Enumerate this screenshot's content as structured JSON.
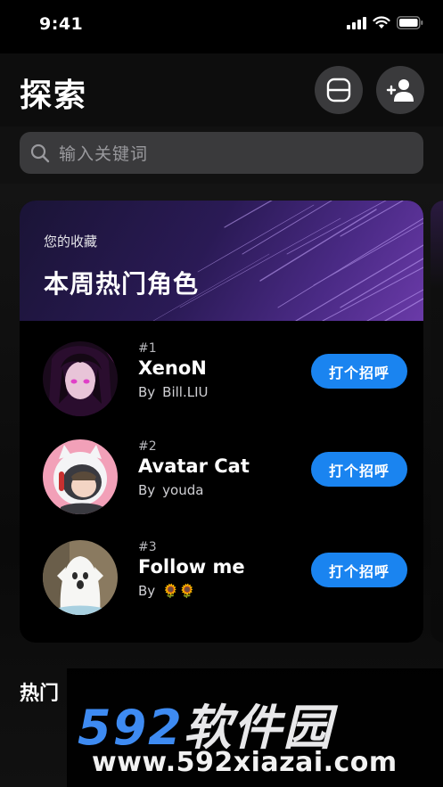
{
  "status": {
    "time": "9:41"
  },
  "header": {
    "title": "探索"
  },
  "search": {
    "placeholder": "输入关键词"
  },
  "card": {
    "subtitle": "您的收藏",
    "title": "本周热门角色",
    "items": [
      {
        "rank": "#1",
        "name": "XenoN",
        "by": "By",
        "author": "Bill.LIU",
        "action": "打个招呼"
      },
      {
        "rank": "#2",
        "name": "Avatar Cat",
        "by": "By",
        "author": "youda",
        "action": "打个招呼"
      },
      {
        "rank": "#3",
        "name": "Follow me",
        "by": "By",
        "author": "🌻🌻",
        "action": "打个招呼"
      }
    ]
  },
  "section": {
    "title": "热门"
  },
  "watermark": {
    "num": "592",
    "text": "软件园",
    "url": "www.592xiazai.com"
  }
}
